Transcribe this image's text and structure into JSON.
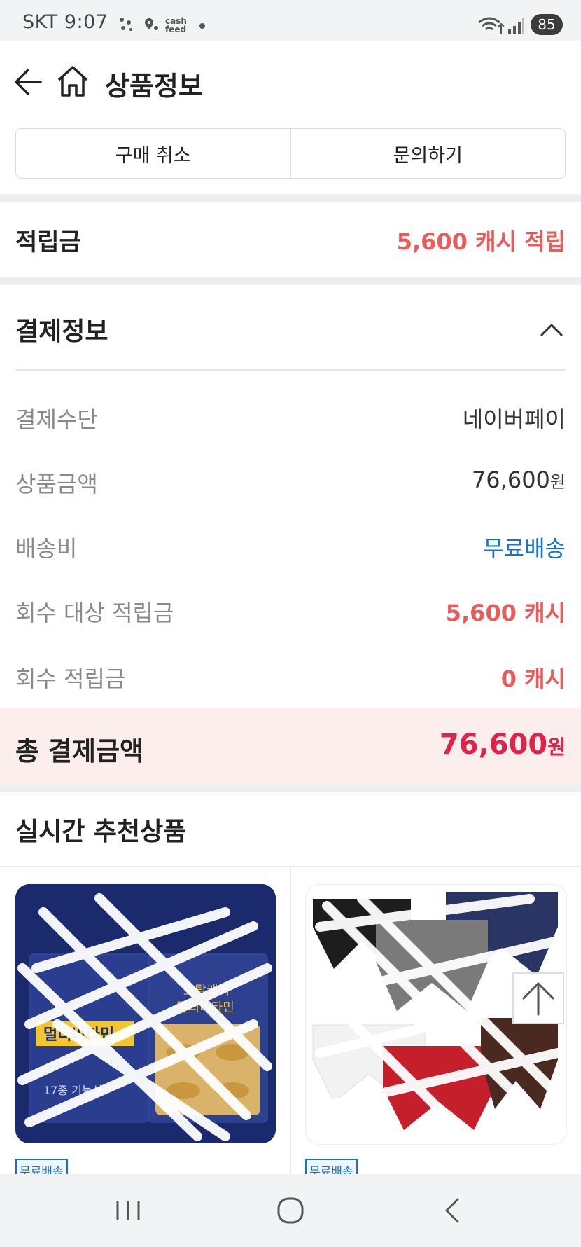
{
  "status_bar": {
    "carrier_time": "SKT 9:07",
    "mini_label_1": "cash",
    "mini_label_2": "feed",
    "battery": "85"
  },
  "header": {
    "title": "상품정보"
  },
  "actions": {
    "cancel_label": "구매 취소",
    "inquiry_label": "문의하기"
  },
  "rewards": {
    "label": "적립금",
    "value": "5,600 캐시 적립"
  },
  "payment": {
    "title": "결제정보",
    "rows": [
      {
        "label": "결제수단",
        "value": "네이버페이",
        "unit": ""
      },
      {
        "label": "상품금액",
        "value": "76,600",
        "unit": "원"
      },
      {
        "label": "배송비",
        "value": "무료배송",
        "unit": ""
      },
      {
        "label": "회수 대상 적립금",
        "value": "5,600 캐시",
        "unit": ""
      },
      {
        "label": "회수 적립금",
        "value": "0 캐시",
        "unit": ""
      }
    ],
    "total_label": "총 결제금액",
    "total_value": "76,600",
    "total_unit": "원"
  },
  "recommend": {
    "title": "실시간 추천상품",
    "products": [
      {
        "badge": "무료배송",
        "image_text_1": "토탈케어",
        "image_text_2": "멀티비타민",
        "image_text_3": "17종 기능성"
      },
      {
        "badge": "무료배송"
      }
    ]
  },
  "colors": {
    "accent_red": "#e85c5c",
    "total_red": "#e0234a",
    "link_blue": "#1a73c9",
    "total_bg": "#fdeeee"
  },
  "icons": {
    "back": "arrow-left-icon",
    "home": "home-icon",
    "collapse": "chevron-up-icon",
    "scroll_top": "arrow-up-icon"
  }
}
